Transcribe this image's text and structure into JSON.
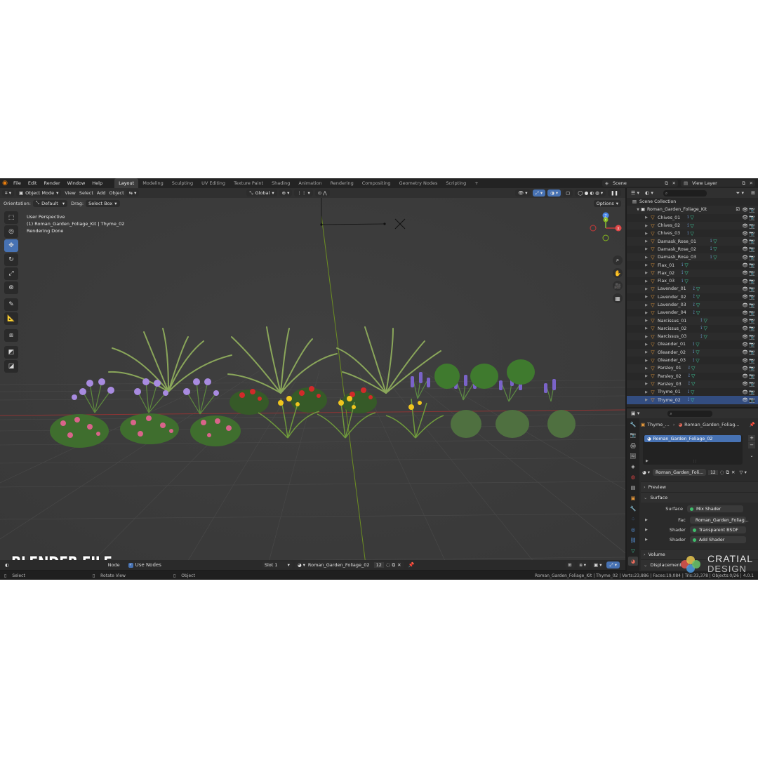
{
  "menu": [
    "File",
    "Edit",
    "Render",
    "Window",
    "Help"
  ],
  "workspaces": [
    "Layout",
    "Modeling",
    "Sculpting",
    "UV Editing",
    "Texture Paint",
    "Shading",
    "Animation",
    "Rendering",
    "Compositing",
    "Geometry Nodes",
    "Scripting"
  ],
  "active_workspace": "Layout",
  "scene": "Scene",
  "view_layer": "View Layer",
  "viewport": {
    "mode": "Object Mode",
    "menu": [
      "View",
      "Select",
      "Add",
      "Object"
    ],
    "transform": "Global",
    "orientation_label": "Orientation:",
    "orientation_value": "Default",
    "drag_label": "Drag:",
    "drag_value": "Select Box",
    "options": "Options",
    "info_line1": "User Perspective",
    "info_line2": "(1) Roman_Garden_Foliage_Kit | Thyme_02",
    "info_line3": "Rendering Done",
    "gizmo": {
      "x": "X",
      "y": "Y",
      "z": "Z"
    }
  },
  "watermark": "BLENDER FILE",
  "shader_bar": {
    "node_label": "Node",
    "use_nodes": "Use Nodes",
    "slot": "Slot 1",
    "material": "Roman_Garden_Foliage_02",
    "users": "12"
  },
  "outliner": {
    "root": "Scene Collection",
    "collection": "Roman_Garden_Foliage_Kit",
    "items": [
      "Chives_01",
      "Chives_02",
      "Chives_03",
      "Damask_Rose_01",
      "Damask_Rose_02",
      "Damask_Rose_03",
      "Flax_01",
      "Flax_02",
      "Flax_03",
      "Lavender_01",
      "Lavender_02",
      "Lavender_03",
      "Lavender_04",
      "Narcissus_01",
      "Narcissus_02",
      "Narcissus_03",
      "Oleander_01",
      "Oleander_02",
      "Oleander_03",
      "Parsley_01",
      "Parsley_02",
      "Parsley_03",
      "Thyme_01",
      "Thyme_02"
    ]
  },
  "properties": {
    "breadcrumb_object": "Thyme_...",
    "breadcrumb_material": "Roman_Garden_Foliag...",
    "slot_material": "Roman_Garden_Foliage_02",
    "material_field": "Roman_Garden_Foli...",
    "material_users": "12",
    "panels": {
      "preview": "Preview",
      "surface": "Surface",
      "volume": "Volume",
      "displacement": "Displacement"
    },
    "surface_label": "Surface",
    "surface_value": "Mix Shader",
    "fac_label": "Fac",
    "fac_value": "Roman_Garden_Foliag...",
    "shader1_label": "Shader",
    "shader1_value": "Transparent BSDF",
    "shader2_label": "Shader",
    "shader2_value": "Add Shader"
  },
  "status": {
    "select": "Select",
    "rotate": "Rotate View",
    "object": "Object",
    "stats": "Roman_Garden_Foliage_Kit | Thyme_02 | Verts:23,886 | Faces:19,084 | Tris:33,378 | Objects:0/26 | 4.0.1"
  },
  "logo": {
    "line1": "CRATIAL",
    "line2": "DESIGN"
  },
  "colors": {
    "accent": "#4772b3",
    "viewport": "#3c3c3c",
    "x_axis": "#c83a3a",
    "y_axis": "#86b71f",
    "mesh": "#3fd4a2",
    "object": "#e89a3b"
  }
}
